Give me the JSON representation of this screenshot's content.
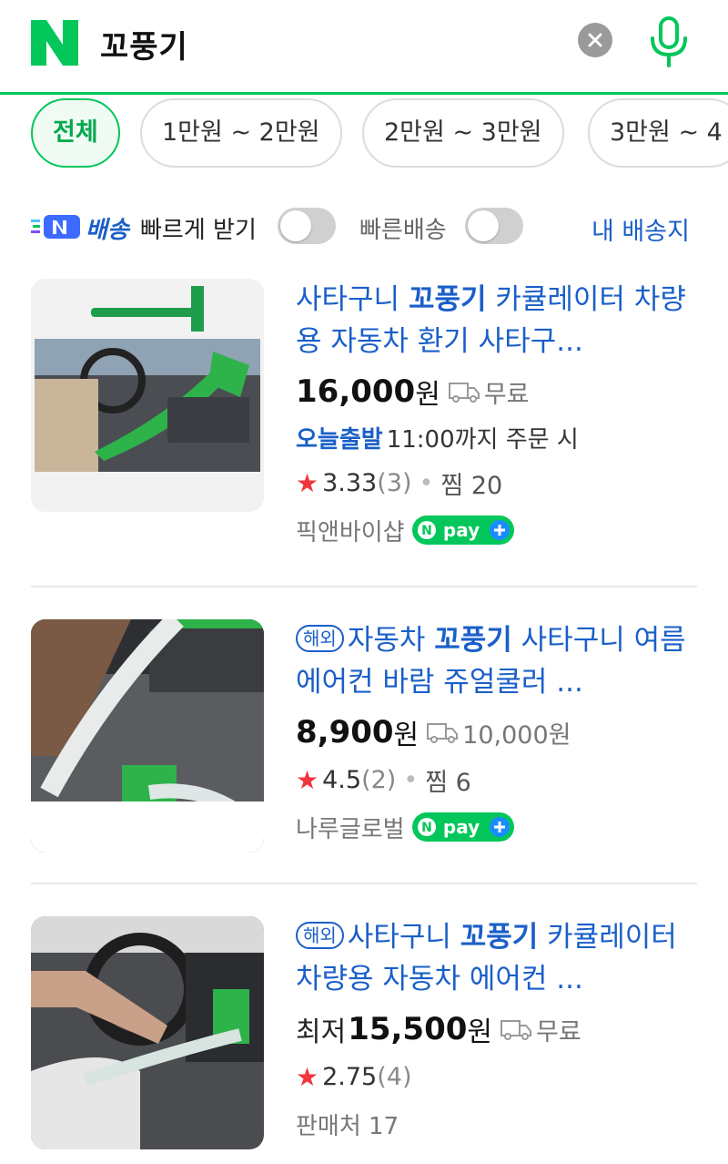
{
  "search": {
    "query": "꼬풍기"
  },
  "price_filters": [
    {
      "label": "전체",
      "active": true
    },
    {
      "label": "1만원 ~ 2만원",
      "active": false
    },
    {
      "label": "2만원 ~ 3만원",
      "active": false
    },
    {
      "label": "3만원 ~ 4",
      "active": false
    }
  ],
  "delivery_filter": {
    "badge_text": "배송",
    "fast_receive_label": "빠르게 받기",
    "fast_receive_on": false,
    "fast_delivery_label": "빠른배송",
    "fast_delivery_on": false,
    "my_address_link": "내 배송지"
  },
  "colors": {
    "brand_green": "#03c75a",
    "link_blue": "#1a5fc9",
    "star_red": "#f0353d"
  },
  "products": [
    {
      "title_pre": "사타구니 ",
      "title_keyword": "꼬풍기",
      "title_post": " 카큘레이터 차량용 자동차 환기 사타구...",
      "overseas": false,
      "price_prefix": "",
      "price": "16,000",
      "currency": "원",
      "shipping": "무료",
      "today_ship_label": "오늘출발",
      "today_ship_text": "11:00까지 주문 시",
      "rating": "3.33",
      "review_count": "(3)",
      "wishlist": "찜 20",
      "seller": "픽앤바이샵",
      "npay": true
    },
    {
      "title_pre": "자동차 ",
      "title_keyword": "꼬풍기",
      "title_post": " 사타구니 여름 에어컨 바람 쥬얼쿨러 ...",
      "overseas": true,
      "overseas_label": "해외",
      "price_prefix": "",
      "price": "8,900",
      "currency": "원",
      "shipping": "10,000원",
      "rating": "4.5",
      "review_count": "(2)",
      "wishlist": "찜 6",
      "seller": "나루글로벌",
      "npay": true
    },
    {
      "title_pre": "사타구니 ",
      "title_keyword": "꼬풍기",
      "title_post": " 카큘레이터 차량용 자동차 에어컨 ...",
      "overseas": true,
      "overseas_label": "해외",
      "price_prefix": "최저",
      "price": "15,500",
      "currency": "원",
      "shipping": "무료",
      "rating": "2.75",
      "review_count": "(4)",
      "seller": "판매처 17",
      "npay": false
    }
  ]
}
